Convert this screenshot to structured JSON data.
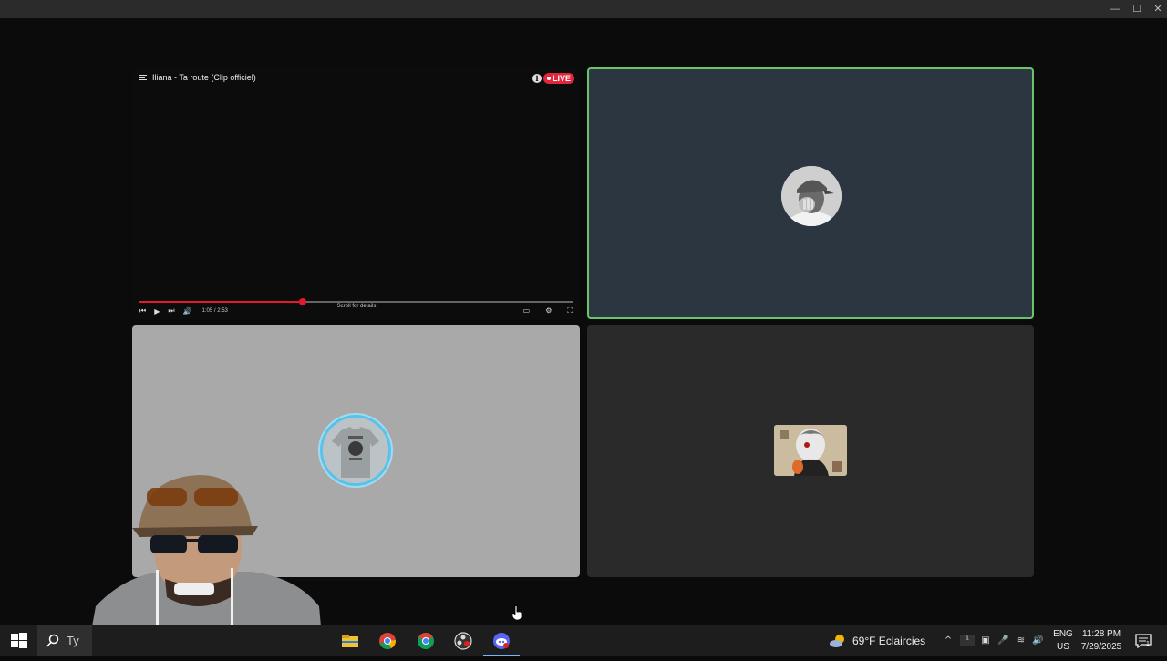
{
  "window": {
    "minimize": "—",
    "maximize": "☐",
    "close": "✕"
  },
  "video_tile": {
    "title": "Iliana - Ta route (Clip officiel)",
    "live_label": "LIVE",
    "info_glyph": "i",
    "progress_fraction": 0.376,
    "time_text": "1:05 / 2:53",
    "scroll_hint": "Scroll for details",
    "controls": {
      "prev": "⏮",
      "play": "▶",
      "next": "⏭",
      "volume": "🔊",
      "captions": "▭",
      "settings": "⚙",
      "fullscreen": "⛶"
    }
  },
  "participants": [
    {
      "id": "cap-user",
      "icon": "avatar-cap-photo",
      "speaking": true
    },
    {
      "id": "shirt-user",
      "icon": "avatar-tshirt-photo",
      "speaking": false
    },
    {
      "id": "anime-user",
      "icon": "avatar-anime-photo",
      "speaking": false
    }
  ],
  "taskbar": {
    "search_text": "Ty",
    "weather": "69°F  Eclaircies",
    "language_top": "ENG",
    "language_bottom": "US",
    "time": "11:28 PM",
    "date": "7/29/2025",
    "notifications_count": "1",
    "apps": [
      "file-explorer-icon",
      "chrome-icon",
      "chrome-dev-icon",
      "obs-icon",
      "discord-icon"
    ]
  },
  "colors": {
    "speaking_border": "#6ac46a",
    "live": "#e2263c",
    "progress": "#e4182f",
    "accent_bar": "#7ab4ff"
  }
}
